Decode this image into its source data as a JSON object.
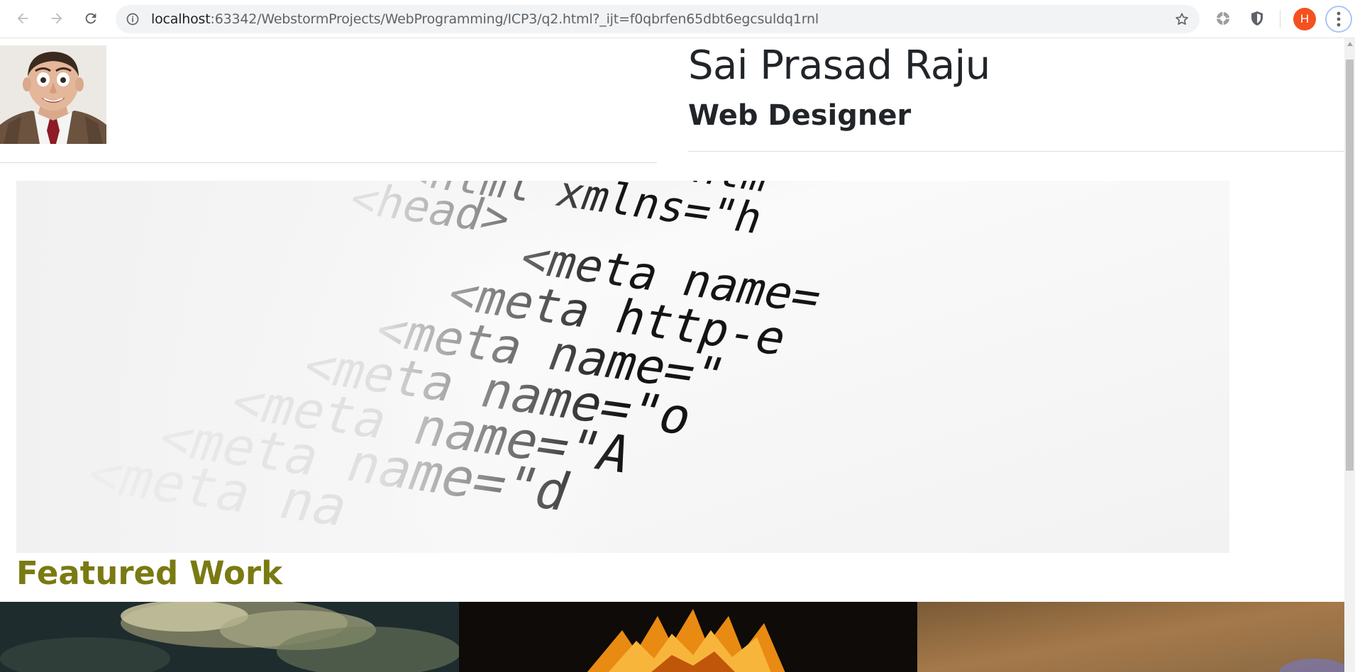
{
  "browser": {
    "url_host": "localhost",
    "url_rest": ":63342/WebstormProjects/WebProgramming/ICP3/q2.html?_ijt=f0qbrfen65dbt6egcsuldq1rnl",
    "profile_initial": "H",
    "icons": [
      "back-arrow-icon",
      "forward-arrow-icon",
      "reload-icon",
      "info-icon",
      "star-icon",
      "extension-icon",
      "shield-icon",
      "kebab-menu-icon"
    ]
  },
  "header": {
    "name": "Sai Prasad Raju",
    "role": "Web Designer"
  },
  "hero": {
    "code_lines": [
      "<!DOCTYPE htm",
      "<html xmlns=\"h",
      "<head>",
      "<meta name=",
      "<meta http-e",
      "<meta name=\"",
      "<meta name=\"o",
      "<meta name=\"A",
      "<meta name=\"d",
      "<meta na"
    ]
  },
  "featured": {
    "heading": "Featured Work",
    "tiles": [
      "clouds-tile",
      "flower-tile",
      "texture-tile"
    ]
  },
  "colors": {
    "heading_olive": "#7a7a12",
    "text_dark": "#212529",
    "avatar_orange": "#f4511e"
  }
}
